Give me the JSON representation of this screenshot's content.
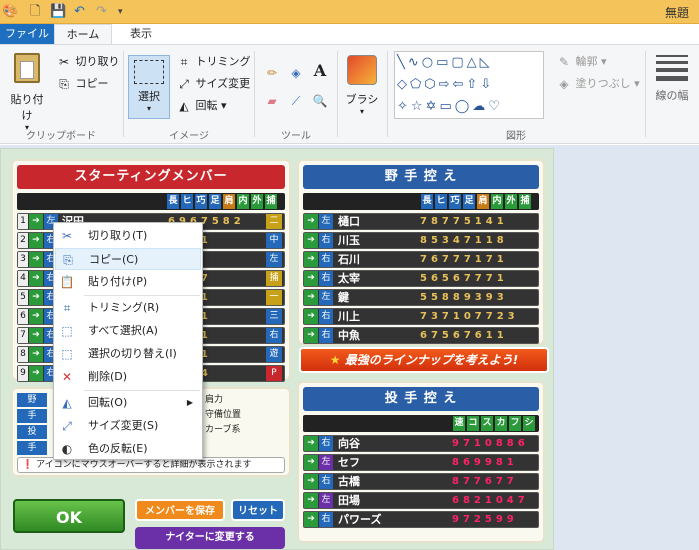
{
  "window": {
    "title": "無題"
  },
  "tabs": {
    "file": "ファイル",
    "home": "ホーム",
    "view": "表示"
  },
  "clipboard": {
    "paste": "貼り付け",
    "cut": "切り取り",
    "copy": "コピー",
    "group": "クリップボード"
  },
  "image": {
    "select": "選択",
    "crop": "トリミング",
    "resize": "サイズ変更",
    "rotate": "回転",
    "group": "イメージ"
  },
  "tools": {
    "group": "ツール"
  },
  "brushes": {
    "label": "ブラシ"
  },
  "shapes": {
    "outline": "輪郭",
    "fill": "塗りつぶし",
    "group": "図形"
  },
  "size": {
    "label": "線の幅"
  },
  "game": {
    "starting_title": "スターティングメンバー",
    "bench_title": "野 手 控 え",
    "pitcher_title": "投 手 控 え",
    "starting_header": [
      "長",
      "ヒ",
      "巧",
      "足",
      "肩",
      "内",
      "外",
      "捕"
    ],
    "bench_header": [
      "長",
      "ヒ",
      "巧",
      "足",
      "肩",
      "内",
      "外",
      "捕"
    ],
    "pitcher_header": [
      "速",
      "コ",
      "ス",
      "カ",
      "フ",
      "シ"
    ],
    "starting": [
      {
        "n": "1",
        "hand": "左",
        "name": "沢田",
        "stats": "6967582",
        "pos": "二"
      },
      {
        "n": "2",
        "hand": "右",
        "name": "",
        "stats": "7791",
        "pos": "中"
      },
      {
        "n": "3",
        "hand": "右",
        "name": "",
        "stats": "761",
        "pos": "左"
      },
      {
        "n": "4",
        "hand": "右",
        "name": "",
        "stats": "7157",
        "pos": "捕"
      },
      {
        "n": "5",
        "hand": "右",
        "name": "",
        "stats": "6541",
        "pos": "一"
      },
      {
        "n": "6",
        "hand": "右",
        "name": "",
        "stats": "7611",
        "pos": "三"
      },
      {
        "n": "7",
        "hand": "右",
        "name": "",
        "stats": "5641",
        "pos": "右"
      },
      {
        "n": "8",
        "hand": "右",
        "name": "",
        "stats": "3191",
        "pos": "遊"
      },
      {
        "n": "9",
        "hand": "右",
        "name": "",
        "stats": "7444",
        "pos": "P"
      }
    ],
    "bench": [
      {
        "hand": "左",
        "name": "樋口",
        "stats": "78775141"
      },
      {
        "hand": "右",
        "name": "川玉",
        "stats": "85347118"
      },
      {
        "hand": "右",
        "name": "石川",
        "stats": "76777171"
      },
      {
        "hand": "右",
        "name": "太宰",
        "stats": "56567771"
      },
      {
        "hand": "左",
        "name": "鍵",
        "stats": "55889393"
      },
      {
        "hand": "右",
        "name": "川上",
        "stats": "737107723"
      },
      {
        "hand": "右",
        "name": "中魚",
        "stats": "67567611"
      }
    ],
    "pitchers": [
      {
        "hand": "右",
        "name": "向谷",
        "stats": "9710886"
      },
      {
        "hand": "左",
        "name": "セフ",
        "stats": "869981"
      },
      {
        "hand": "右",
        "name": "古橋",
        "stats": "877677"
      },
      {
        "hand": "左",
        "name": "田場",
        "stats": "6821047"
      },
      {
        "hand": "右",
        "name": "パワーズ",
        "stats": "972599"
      }
    ],
    "banner": "最強のラインナップを考えよう!",
    "legend": {
      "a": "肩力",
      "b": "守備位置",
      "c": "カーブ系",
      "keys": [
        "野",
        "手",
        "投",
        "手"
      ]
    },
    "notice": "アイコンにマウスオーバーすると詳細が表示されます",
    "ok": "OK",
    "save": "メンバーを保存",
    "reset": "リセット",
    "night": "ナイターに変更する"
  },
  "context_menu": {
    "items": [
      {
        "label": "切り取り(T)",
        "icon": "scissors-icon",
        "key": "cut"
      },
      {
        "label": "コピー(C)",
        "icon": "copy-icon",
        "key": "copy"
      },
      {
        "label": "貼り付け(P)",
        "icon": "paste-icon",
        "key": "paste"
      },
      {
        "label": "トリミング(R)",
        "icon": "crop-icon",
        "key": "crop"
      },
      {
        "label": "すべて選択(A)",
        "icon": "select-all-icon",
        "key": "selectall"
      },
      {
        "label": "選択の切り替え(I)",
        "icon": "invert-selection-icon",
        "key": "invert"
      },
      {
        "label": "削除(D)",
        "icon": "delete-icon",
        "key": "delete"
      },
      {
        "label": "回転(O)",
        "icon": "rotate-icon",
        "key": "rotate"
      },
      {
        "label": "サイズ変更(S)",
        "icon": "resize-icon",
        "key": "resize"
      },
      {
        "label": "色の反転(E)",
        "icon": "invert-color-icon",
        "key": "invertcolor"
      }
    ]
  }
}
